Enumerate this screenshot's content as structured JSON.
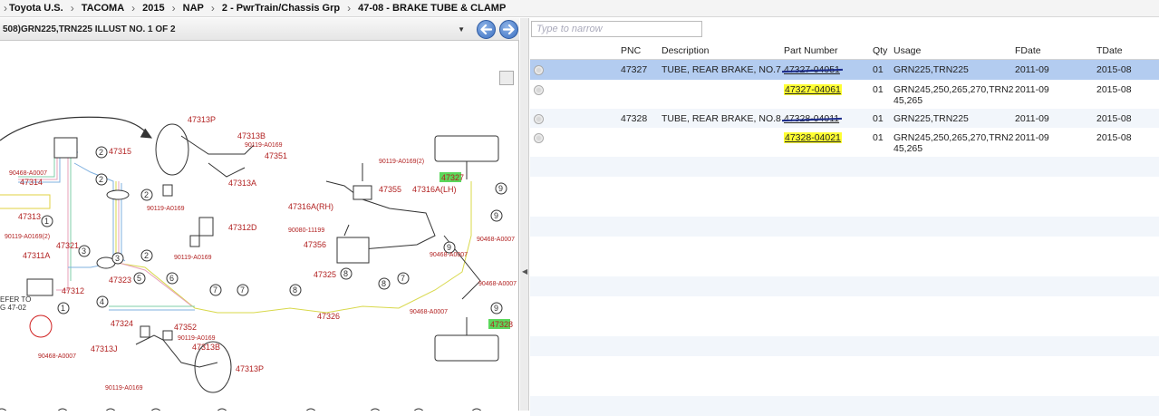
{
  "breadcrumb": [
    "Toyota U.S.",
    "TACOMA",
    "2015",
    "NAP",
    "2 - PwrTrain/Chassis Grp",
    "47-08 - BRAKE TUBE & CLAMP"
  ],
  "illustration": {
    "selected": "508)GRN225,TRN225 ILLUST NO. 1 OF 2",
    "labels": {
      "l47313P_top": "47313P",
      "l47313B_top": "47313B",
      "l90119_a": "90119-A0169",
      "l47351": "47351",
      "l47315": "47315",
      "l90468_a": "90468-A0007",
      "l47314": "47314",
      "l47313A": "47313A",
      "l90119_b": "90119-A0169",
      "l47313": "47313",
      "l47312D": "47312D",
      "l90119_2": "90119-A0169(2)",
      "l47321": "47321",
      "l47311A": "47311A",
      "l90119_c": "90119-A0169",
      "l47323": "47323",
      "l47312": "47312",
      "lrefer1": "EFER TO",
      "lrefer2": "G 47-02",
      "l47324": "47324",
      "l47352": "47352",
      "l90119_d": "90119-A0169",
      "l47313B_bot": "47313B",
      "l47313J": "47313J",
      "l90468_b": "90468-A0007",
      "l47313P_bot": "47313P",
      "l90119_e": "90119-A0169",
      "l90119_2b": "90119-A0169(2)",
      "l47355": "47355",
      "l47316A_LH": "47316A(LH)",
      "l47316A_RH": "47316A(RH)",
      "l90080": "90080-11199",
      "l47356": "47356",
      "l90468_c": "90468-A0007",
      "l90468_d": "90468-A0007",
      "l90468_e": "90468-A0007",
      "l90468_f": "90468-A0007",
      "l47325": "47325",
      "l47326": "47326",
      "l47327": "47327",
      "l47328": "47328"
    }
  },
  "filter": {
    "placeholder": "Type to narrow"
  },
  "columns": {
    "pnc": "PNC",
    "description": "Description",
    "part_number": "Part Number",
    "qty": "Qty",
    "usage": "Usage",
    "fdate": "FDate",
    "tdate": "TDate"
  },
  "rows": [
    {
      "pnc": "47327",
      "description": "TUBE, REAR BRAKE, NO.7",
      "part_number": "47327-04051",
      "qty": "01",
      "usage": "GRN225,TRN225",
      "fdate": "2011-09",
      "tdate": "2015-08"
    },
    {
      "pnc": "",
      "description": "",
      "part_number": "47327-04061",
      "qty": "01",
      "usage_line1": "GRN245,250,265,270,TRN2",
      "usage_line2": "45,265",
      "fdate": "2011-09",
      "tdate": "2015-08"
    },
    {
      "pnc": "47328",
      "description": "TUBE, REAR BRAKE, NO.8",
      "part_number": "47328-04011",
      "qty": "01",
      "usage": "GRN225,TRN225",
      "fdate": "2011-09",
      "tdate": "2015-08"
    },
    {
      "pnc": "",
      "description": "",
      "part_number": "47328-04021",
      "qty": "01",
      "usage_line1": "GRN245,250,265,270,TRN2",
      "usage_line2": "45,265",
      "fdate": "2011-09",
      "tdate": "2015-08"
    }
  ]
}
